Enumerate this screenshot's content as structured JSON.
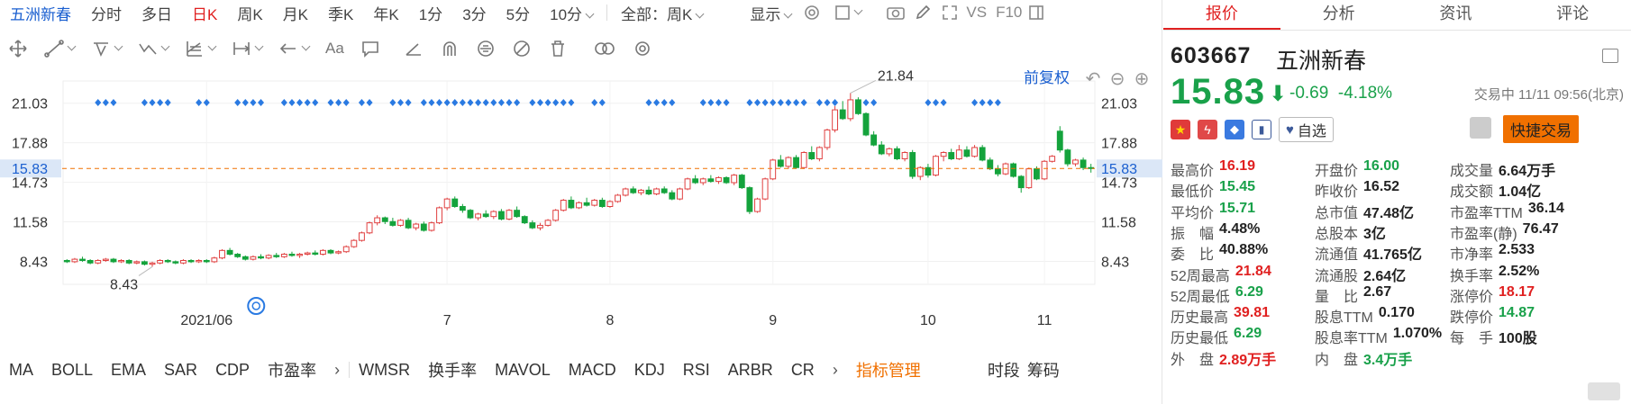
{
  "toolbar": {
    "items": [
      {
        "label": "五洲新春",
        "type": "stock"
      },
      {
        "label": "分时"
      },
      {
        "label": "多日"
      },
      {
        "label": "日K",
        "active": true
      },
      {
        "label": "周K"
      },
      {
        "label": "月K"
      },
      {
        "label": "季K"
      },
      {
        "label": "年K"
      },
      {
        "label": "1分"
      },
      {
        "label": "3分"
      },
      {
        "label": "5分"
      },
      {
        "label": "10分"
      }
    ],
    "period_dropdown": "全部：周K",
    "display_dropdown": "显示",
    "vs": "VS",
    "f10": "F10"
  },
  "tools": {
    "text_tool": "Aa"
  },
  "chart_data": {
    "type": "candlestick",
    "title": "",
    "xlabel": "",
    "ylabel": "",
    "yticks": [
      8.43,
      11.58,
      14.73,
      17.88,
      21.03
    ],
    "ylim": [
      6.6,
      22.8
    ],
    "xticks": [
      "2021/06",
      "7",
      "8",
      "9",
      "10",
      "11"
    ],
    "xtick_index": [
      18,
      49,
      70,
      91,
      111,
      126
    ],
    "current_price": 15.83,
    "high_label": 21.84,
    "low_label": 8.43,
    "adjust_label": "前复权",
    "up_color": "#e04040",
    "down_color": "#14a33c",
    "price_line_color": "#f07000",
    "marker_color": "#2a7ae2",
    "marker_groups": [
      [
        4,
        6
      ],
      [
        10,
        13
      ],
      [
        17,
        18
      ],
      [
        22,
        25
      ],
      [
        28,
        32
      ],
      [
        34,
        36
      ],
      [
        38,
        39
      ],
      [
        42,
        44
      ],
      [
        46,
        55
      ],
      [
        56,
        58
      ],
      [
        60,
        65
      ],
      [
        68,
        69
      ],
      [
        75,
        78
      ],
      [
        82,
        85
      ],
      [
        88,
        95
      ],
      [
        97,
        99
      ],
      [
        103,
        104
      ],
      [
        111,
        113
      ],
      [
        117,
        120
      ]
    ],
    "ohlc": [
      [
        8.5,
        8.6,
        8.3,
        8.4
      ],
      [
        8.4,
        8.7,
        8.3,
        8.6
      ],
      [
        8.6,
        8.8,
        8.4,
        8.5
      ],
      [
        8.5,
        8.6,
        8.2,
        8.3
      ],
      [
        8.3,
        8.6,
        8.2,
        8.5
      ],
      [
        8.5,
        8.7,
        8.4,
        8.6
      ],
      [
        8.6,
        8.7,
        8.3,
        8.4
      ],
      [
        8.4,
        8.6,
        8.3,
        8.5
      ],
      [
        8.5,
        8.6,
        8.2,
        8.3
      ],
      [
        8.3,
        8.5,
        8.2,
        8.4
      ],
      [
        8.4,
        8.5,
        8.1,
        8.2
      ],
      [
        8.2,
        8.4,
        8.0,
        8.3
      ],
      [
        8.3,
        8.6,
        8.2,
        8.5
      ],
      [
        8.5,
        8.6,
        8.3,
        8.4
      ],
      [
        8.4,
        8.5,
        8.2,
        8.3
      ],
      [
        8.3,
        8.6,
        8.2,
        8.5
      ],
      [
        8.5,
        8.6,
        8.3,
        8.4
      ],
      [
        8.4,
        8.6,
        8.3,
        8.5
      ],
      [
        8.5,
        8.6,
        8.3,
        8.4
      ],
      [
        8.4,
        8.8,
        8.3,
        8.7
      ],
      [
        8.7,
        9.4,
        8.6,
        9.3
      ],
      [
        9.3,
        9.5,
        8.9,
        9.0
      ],
      [
        9.0,
        9.1,
        8.7,
        8.8
      ],
      [
        8.8,
        8.9,
        8.5,
        8.6
      ],
      [
        8.6,
        8.9,
        8.5,
        8.8
      ],
      [
        8.8,
        9.0,
        8.6,
        8.7
      ],
      [
        8.7,
        9.0,
        8.6,
        8.9
      ],
      [
        8.9,
        9.1,
        8.7,
        8.8
      ],
      [
        8.8,
        9.1,
        8.7,
        9.0
      ],
      [
        9.0,
        9.2,
        8.8,
        8.9
      ],
      [
        8.9,
        9.1,
        8.7,
        9.0
      ],
      [
        9.0,
        9.2,
        8.9,
        9.1
      ],
      [
        9.1,
        9.3,
        8.9,
        9.0
      ],
      [
        9.0,
        9.4,
        8.9,
        9.3
      ],
      [
        9.3,
        9.4,
        9.0,
        9.1
      ],
      [
        9.1,
        9.3,
        9.0,
        9.2
      ],
      [
        9.2,
        9.7,
        9.1,
        9.6
      ],
      [
        9.6,
        10.2,
        9.5,
        10.1
      ],
      [
        10.1,
        10.8,
        10.0,
        10.7
      ],
      [
        10.7,
        11.6,
        10.6,
        11.5
      ],
      [
        11.5,
        12.1,
        11.3,
        11.9
      ],
      [
        11.9,
        12.0,
        11.4,
        11.6
      ],
      [
        11.6,
        11.9,
        11.2,
        11.3
      ],
      [
        11.3,
        11.8,
        11.2,
        11.7
      ],
      [
        11.7,
        11.9,
        11.0,
        11.1
      ],
      [
        11.1,
        11.5,
        10.9,
        11.4
      ],
      [
        11.4,
        11.6,
        10.8,
        10.9
      ],
      [
        10.9,
        11.6,
        10.8,
        11.5
      ],
      [
        11.5,
        12.8,
        11.4,
        12.7
      ],
      [
        12.7,
        13.5,
        12.5,
        13.4
      ],
      [
        13.4,
        13.6,
        12.7,
        12.8
      ],
      [
        12.8,
        13.0,
        12.3,
        12.5
      ],
      [
        12.5,
        12.6,
        11.8,
        11.9
      ],
      [
        11.9,
        12.3,
        11.7,
        12.2
      ],
      [
        12.2,
        12.5,
        11.9,
        12.0
      ],
      [
        12.0,
        12.5,
        11.8,
        12.4
      ],
      [
        12.4,
        12.6,
        11.7,
        11.8
      ],
      [
        11.8,
        12.6,
        11.7,
        12.5
      ],
      [
        12.5,
        12.8,
        11.9,
        12.0
      ],
      [
        12.0,
        12.1,
        11.4,
        11.5
      ],
      [
        11.5,
        11.7,
        11.0,
        11.1
      ],
      [
        11.1,
        11.5,
        10.9,
        11.3
      ],
      [
        11.3,
        11.8,
        11.2,
        11.7
      ],
      [
        11.7,
        12.6,
        11.6,
        12.5
      ],
      [
        12.5,
        13.4,
        12.4,
        13.3
      ],
      [
        13.3,
        13.6,
        12.6,
        12.7
      ],
      [
        12.7,
        13.2,
        12.6,
        13.1
      ],
      [
        13.1,
        13.5,
        12.8,
        12.9
      ],
      [
        12.9,
        13.4,
        12.8,
        13.3
      ],
      [
        13.3,
        13.5,
        12.7,
        12.8
      ],
      [
        12.8,
        13.3,
        12.7,
        13.2
      ],
      [
        13.2,
        13.8,
        13.1,
        13.7
      ],
      [
        13.7,
        14.3,
        13.6,
        14.2
      ],
      [
        14.2,
        14.4,
        13.8,
        13.9
      ],
      [
        13.9,
        14.2,
        13.7,
        14.1
      ],
      [
        14.1,
        14.4,
        13.7,
        13.8
      ],
      [
        13.8,
        14.3,
        13.7,
        14.2
      ],
      [
        14.2,
        14.4,
        13.8,
        13.9
      ],
      [
        13.9,
        14.1,
        13.3,
        13.4
      ],
      [
        13.4,
        14.3,
        13.3,
        14.2
      ],
      [
        14.2,
        15.1,
        14.1,
        15.0
      ],
      [
        15.0,
        15.3,
        14.6,
        14.7
      ],
      [
        14.7,
        15.1,
        14.5,
        15.0
      ],
      [
        15.0,
        15.3,
        14.7,
        14.8
      ],
      [
        14.8,
        15.2,
        14.6,
        15.1
      ],
      [
        15.1,
        15.2,
        14.6,
        14.7
      ],
      [
        14.7,
        15.4,
        14.5,
        15.3
      ],
      [
        15.3,
        15.4,
        14.2,
        14.3
      ],
      [
        14.3,
        14.4,
        12.2,
        12.4
      ],
      [
        12.4,
        13.5,
        12.3,
        13.4
      ],
      [
        13.4,
        15.1,
        13.3,
        15.0
      ],
      [
        15.0,
        16.6,
        14.9,
        16.5
      ],
      [
        16.5,
        16.9,
        15.9,
        16.0
      ],
      [
        16.0,
        16.8,
        15.8,
        16.7
      ],
      [
        16.7,
        16.9,
        15.8,
        15.9
      ],
      [
        15.9,
        17.2,
        15.8,
        17.1
      ],
      [
        17.1,
        17.6,
        16.5,
        16.6
      ],
      [
        16.6,
        17.6,
        16.4,
        17.5
      ],
      [
        17.5,
        19.0,
        17.3,
        18.9
      ],
      [
        18.9,
        20.8,
        18.7,
        20.5
      ],
      [
        20.5,
        21.2,
        19.7,
        19.8
      ],
      [
        19.8,
        21.84,
        19.6,
        21.3
      ],
      [
        21.3,
        21.5,
        20.1,
        20.2
      ],
      [
        20.2,
        20.3,
        18.4,
        18.5
      ],
      [
        18.5,
        18.8,
        17.6,
        17.7
      ],
      [
        17.7,
        18.0,
        16.9,
        17.0
      ],
      [
        17.0,
        17.5,
        16.8,
        17.4
      ],
      [
        17.4,
        17.6,
        16.5,
        16.6
      ],
      [
        16.6,
        17.2,
        16.4,
        17.1
      ],
      [
        17.1,
        17.3,
        15.0,
        15.2
      ],
      [
        15.2,
        16.0,
        14.9,
        15.9
      ],
      [
        15.9,
        16.2,
        15.1,
        15.3
      ],
      [
        15.3,
        16.9,
        15.2,
        16.8
      ],
      [
        16.8,
        17.2,
        16.4,
        17.1
      ],
      [
        17.1,
        17.4,
        16.5,
        16.6
      ],
      [
        16.6,
        17.7,
        16.5,
        17.3
      ],
      [
        17.3,
        17.6,
        16.7,
        16.8
      ],
      [
        16.8,
        17.7,
        16.7,
        17.5
      ],
      [
        17.5,
        17.7,
        16.4,
        16.5
      ],
      [
        16.5,
        16.7,
        15.7,
        15.8
      ],
      [
        15.8,
        16.1,
        15.2,
        15.4
      ],
      [
        15.4,
        16.3,
        15.3,
        16.2
      ],
      [
        16.2,
        16.3,
        15.1,
        15.2
      ],
      [
        15.2,
        15.3,
        13.9,
        14.3
      ],
      [
        14.3,
        15.9,
        14.2,
        15.8
      ],
      [
        15.8,
        16.0,
        14.9,
        15.0
      ],
      [
        15.0,
        16.5,
        14.9,
        16.4
      ],
      [
        16.4,
        16.9,
        16.3,
        16.8
      ],
      [
        18.8,
        19.2,
        17.1,
        17.3
      ],
      [
        17.3,
        17.4,
        16.0,
        16.2
      ],
      [
        16.2,
        16.6,
        16.0,
        16.5
      ],
      [
        16.5,
        16.7,
        15.7,
        15.9
      ],
      [
        15.9,
        16.2,
        15.5,
        15.83
      ]
    ]
  },
  "indicators": {
    "items": [
      "MA",
      "BOLL",
      "EMA",
      "SAR",
      "CDP",
      "市盈率"
    ],
    "items2": [
      "WMSR",
      "换手率",
      "MAVOL",
      "MACD",
      "KDJ",
      "RSI",
      "ARBR",
      "CR"
    ],
    "manage": "指标管理",
    "right": "时段",
    "right2": "筹码"
  },
  "quote": {
    "tabs": [
      "报价",
      "分析",
      "资讯",
      "评论"
    ],
    "active_tab": 0,
    "code": "603667",
    "name": "五洲新春",
    "price": "15.83",
    "change": "-0.69",
    "change_pct": "-4.18%",
    "status": "交易中 11/11 09:56(北京)",
    "watch_label": "自选",
    "fast_trade": "快捷交易",
    "badge_colors": [
      "#e03a3a",
      "#e04848",
      "#3a7ae0",
      "#3c5a9a"
    ],
    "stats": [
      [
        [
          "最高价",
          "16.19",
          "r"
        ],
        [
          "开盘价",
          "16.00",
          "g"
        ],
        [
          "成交量",
          "6.64万手",
          "k"
        ]
      ],
      [
        [
          "最低价",
          "15.45",
          "g"
        ],
        [
          "昨收价",
          "16.52",
          "k"
        ],
        [
          "成交额",
          "1.04亿",
          "k"
        ]
      ],
      [
        [
          "平均价",
          "15.71",
          "g"
        ],
        [
          "总市值",
          "47.48亿",
          "k"
        ],
        [
          "市盈率TTM",
          "36.14",
          "k"
        ]
      ],
      [
        [
          "振　幅",
          "4.48%",
          "k"
        ],
        [
          "总股本",
          "3亿",
          "k"
        ],
        [
          "市盈率(静)",
          "76.47",
          "k"
        ]
      ],
      [
        [
          "委　比",
          "40.88%",
          "k"
        ],
        [
          "流通值",
          "41.765亿",
          "k"
        ],
        [
          "市净率",
          "2.533",
          "k"
        ]
      ],
      [
        [
          "52周最高",
          "21.84",
          "r"
        ],
        [
          "流通股",
          "2.64亿",
          "k"
        ],
        [
          "换手率",
          "2.52%",
          "k"
        ]
      ],
      [
        [
          "52周最低",
          "6.29",
          "g"
        ],
        [
          "量　比",
          "2.67",
          "k"
        ],
        [
          "涨停价",
          "18.17",
          "r"
        ]
      ],
      [
        [
          "历史最高",
          "39.81",
          "r"
        ],
        [
          "股息TTM",
          "0.170",
          "k"
        ],
        [
          "跌停价",
          "14.87",
          "g"
        ]
      ],
      [
        [
          "历史最低",
          "6.29",
          "g"
        ],
        [
          "股息率TTM",
          "1.070%",
          "k"
        ],
        [
          "每　手",
          "100股",
          "k"
        ]
      ],
      [
        [
          "外　盘",
          "2.89万手",
          "r"
        ],
        [
          "内　盘",
          "3.4万手",
          "g"
        ]
      ]
    ]
  }
}
